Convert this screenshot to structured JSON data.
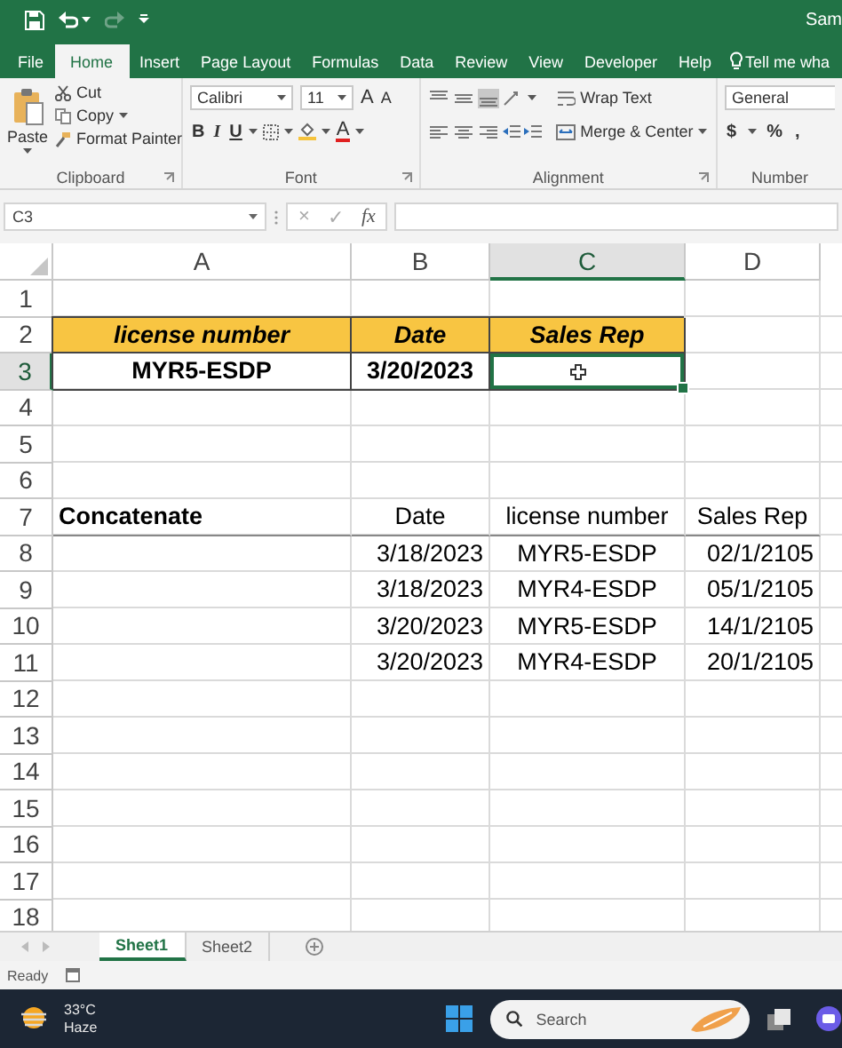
{
  "title_bar": {
    "title": "Sam"
  },
  "ribbon_tabs": [
    {
      "label": "File",
      "selected": false
    },
    {
      "label": "Home",
      "selected": true
    },
    {
      "label": "Insert",
      "selected": false
    },
    {
      "label": "Page Layout",
      "selected": false
    },
    {
      "label": "Formulas",
      "selected": false
    },
    {
      "label": "Data",
      "selected": false
    },
    {
      "label": "Review",
      "selected": false
    },
    {
      "label": "View",
      "selected": false
    },
    {
      "label": "Developer",
      "selected": false
    },
    {
      "label": "Help",
      "selected": false
    }
  ],
  "tell_me": "Tell me wha",
  "ribbon": {
    "clipboard": {
      "paste": "Paste",
      "cut": "Cut",
      "copy": "Copy",
      "format_painter": "Format Painter",
      "label": "Clipboard"
    },
    "font": {
      "font_name": "Calibri",
      "font_size": "11",
      "grow": "A",
      "shrink": "A",
      "styles": [
        "B",
        "I",
        "U"
      ],
      "font_color": "A",
      "label": "Font"
    },
    "alignment": {
      "vertical_align": [
        {
          "selected": false
        },
        {
          "selected": false
        },
        {
          "selected": true
        }
      ],
      "wrap_text": "Wrap Text",
      "merge": "Merge & Center",
      "label": "Alignment"
    },
    "number": {
      "format": "General",
      "symbols": [
        "$",
        "%",
        ","
      ],
      "label": "Number"
    }
  },
  "formula_bar": {
    "name_box": "C3",
    "cancel": "×",
    "enter": "✓",
    "function": "fx"
  },
  "sheet": {
    "columns": [
      {
        "label": "A",
        "selected": false
      },
      {
        "label": "B",
        "selected": false
      },
      {
        "label": "C",
        "selected": true
      },
      {
        "label": "D",
        "selected": false
      }
    ],
    "rows": [
      {
        "number": "1",
        "selected": false
      },
      {
        "number": "2",
        "selected": false,
        "cells": [
          {
            "kind": "title",
            "text": "license number"
          },
          {
            "kind": "title",
            "text": "Date"
          },
          {
            "kind": "title",
            "text": "Sales Rep"
          },
          {
            "kind": "blank"
          }
        ]
      },
      {
        "number": "3",
        "selected": true,
        "cells": [
          {
            "kind": "boxed",
            "text": "MYR5-ESDP"
          },
          {
            "kind": "boxed",
            "text": "3/20/2023"
          },
          {
            "kind": "boxed"
          },
          {
            "kind": "blank"
          }
        ]
      },
      {
        "number": "4",
        "selected": false
      },
      {
        "number": "5",
        "selected": false
      },
      {
        "number": "6",
        "selected": false
      },
      {
        "number": "7",
        "selected": false,
        "cells": [
          {
            "kind": "label",
            "text": "Concatenate"
          },
          {
            "kind": "heading",
            "text": "Date"
          },
          {
            "kind": "heading",
            "text": "license number"
          },
          {
            "kind": "heading",
            "text": "Sales Rep"
          }
        ]
      },
      {
        "number": "8",
        "selected": false,
        "cells": [
          {
            "kind": "blank"
          },
          {
            "kind": "number",
            "text": "3/18/2023"
          },
          {
            "kind": "text",
            "text": "MYR5-ESDP"
          },
          {
            "kind": "number",
            "text": "02/1/2105"
          }
        ]
      },
      {
        "number": "9",
        "selected": false,
        "cells": [
          {
            "kind": "blank"
          },
          {
            "kind": "number",
            "text": "3/18/2023"
          },
          {
            "kind": "text",
            "text": "MYR4-ESDP"
          },
          {
            "kind": "number",
            "text": "05/1/2105"
          }
        ]
      },
      {
        "number": "10",
        "selected": false,
        "cells": [
          {
            "kind": "blank"
          },
          {
            "kind": "number",
            "text": "3/20/2023"
          },
          {
            "kind": "text",
            "text": "MYR5-ESDP"
          },
          {
            "kind": "number",
            "text": "14/1/2105"
          }
        ]
      },
      {
        "number": "11",
        "selected": false,
        "cells": [
          {
            "kind": "blank"
          },
          {
            "kind": "number",
            "text": "3/20/2023"
          },
          {
            "kind": "text",
            "text": "MYR4-ESDP"
          },
          {
            "kind": "number",
            "text": "20/1/2105"
          }
        ]
      },
      {
        "number": "12",
        "selected": false
      },
      {
        "number": "13",
        "selected": false
      },
      {
        "number": "14",
        "selected": false
      },
      {
        "number": "15",
        "selected": false
      },
      {
        "number": "16",
        "selected": false
      },
      {
        "number": "17",
        "selected": false
      },
      {
        "number": "18",
        "selected": false
      }
    ]
  },
  "sheet_tabs": [
    {
      "label": "Sheet1",
      "selected": true
    },
    {
      "label": "Sheet2",
      "selected": false
    }
  ],
  "status_bar": {
    "status": "Ready"
  },
  "taskbar": {
    "temperature": "33°C",
    "weather": "Haze",
    "search": {
      "placeholder": "Search"
    }
  }
}
